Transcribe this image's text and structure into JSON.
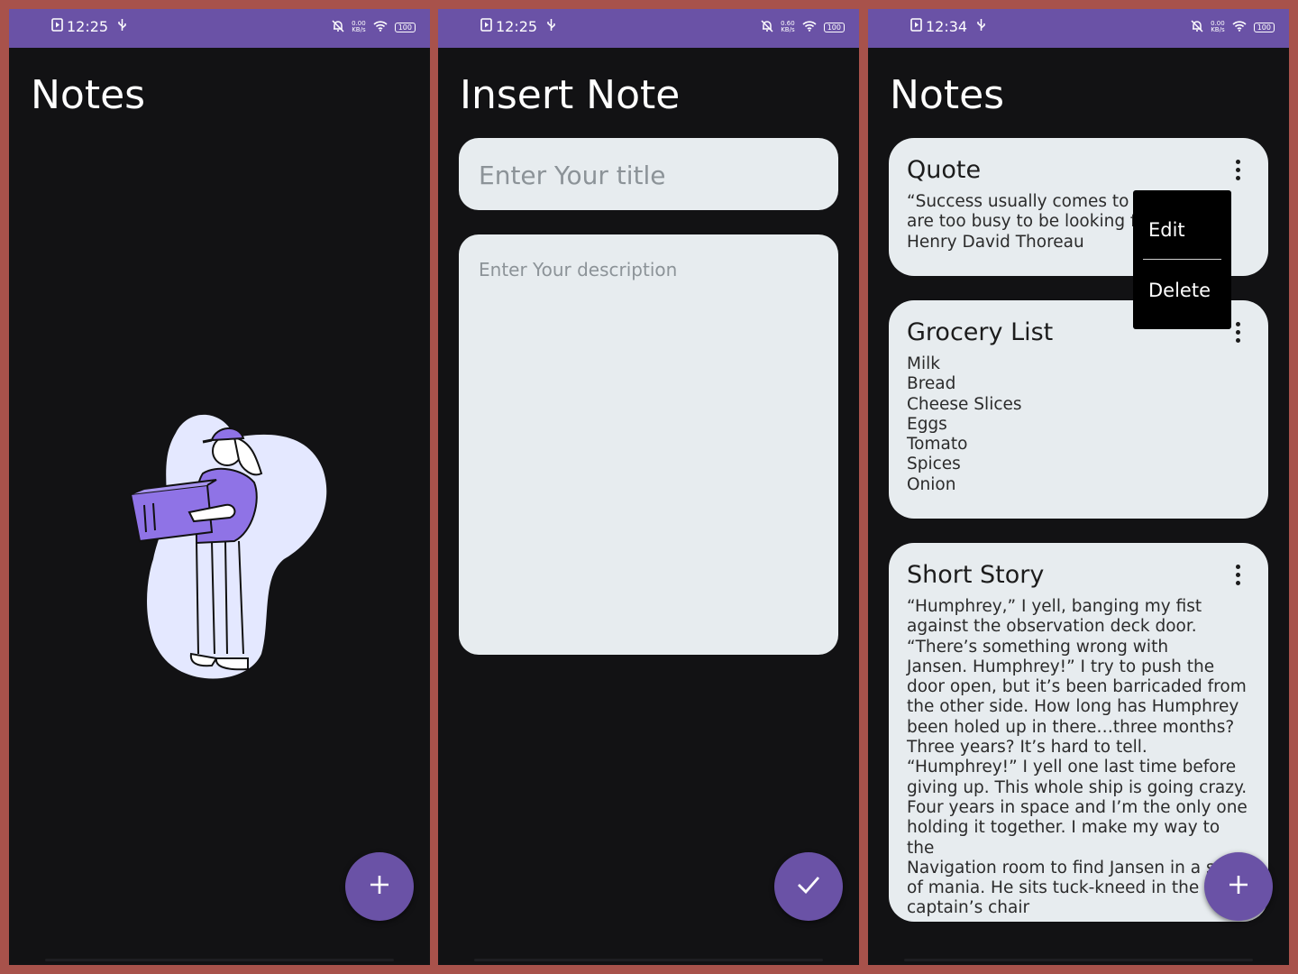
{
  "status_bars": [
    {
      "time": "12:25",
      "speed": "0.00",
      "speed_unit": "KB/s",
      "battery": "100"
    },
    {
      "time": "12:25",
      "speed": "0.60",
      "speed_unit": "KB/s",
      "battery": "100"
    },
    {
      "time": "12:34",
      "speed": "0.00",
      "speed_unit": "KB/s",
      "battery": "100"
    }
  ],
  "screen1": {
    "title": "Notes",
    "fab_icon": "plus-icon"
  },
  "screen2": {
    "title": "Insert Note",
    "title_placeholder": "Enter Your title",
    "description_placeholder": "Enter Your description",
    "fab_icon": "check-icon"
  },
  "screen3": {
    "title": "Notes",
    "notes": [
      {
        "title": "Quote",
        "body": "“Success usually comes to those who\nare too busy to be looking for it.” —\nHenry David Thoreau"
      },
      {
        "title": "Grocery List",
        "body": "Milk\nBread\nCheese Slices\nEggs\nTomato\nSpices\nOnion"
      },
      {
        "title": "Short Story",
        "body": "“Humphrey,” I yell, banging my fist\nagainst the observation deck door.\n“There’s something wrong with\nJansen. Humphrey!” I try to push the\ndoor open, but it’s been barricaded from\nthe other side. How long has Humphrey\nbeen holed up in there…three months?\nThree years? It’s hard to tell.\n“Humphrey!” I yell one last time before\ngiving up. This whole ship is going crazy.\nFour years in space and I’m the only one\nholding it together. I make my way to the\nNavigation room to find Jansen in a state\nof mania. He sits tuck-kneed in the\ncaptain’s chair"
      }
    ],
    "menu": {
      "edit": "Edit",
      "delete": "Delete"
    },
    "fab_icon": "plus-icon"
  },
  "colors": {
    "accent": "#6a52a6",
    "background": "#121214",
    "card": "#e7ecef",
    "frame": "#a8524b"
  }
}
